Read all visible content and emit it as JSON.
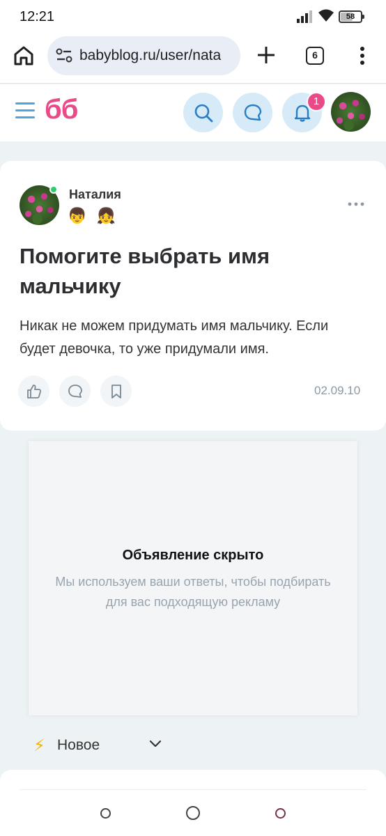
{
  "status": {
    "time": "12:21",
    "battery": "58"
  },
  "browser": {
    "url": "babyblog.ru/user/nata",
    "tab_count": "6"
  },
  "site": {
    "logo": "бб",
    "notification_count": "1"
  },
  "post": {
    "author": "Наталия",
    "kids": "👦 👧",
    "title": "Помогите выбрать имя мальчику",
    "text": "Никак не можем придумать имя мальчику. Если будет девочка, то уже придумали имя.",
    "date": "02.09.10"
  },
  "ad": {
    "title": "Объявление скрыто",
    "description": "Мы используем ваши ответы, чтобы подбирать для вас подходящую рекламу"
  },
  "feed": {
    "filter_label": "Новое",
    "filter_icon": "⚡"
  },
  "colors": {
    "brand": "#ea4a88",
    "accent": "#4aa5e0",
    "online": "#2ecc71"
  }
}
